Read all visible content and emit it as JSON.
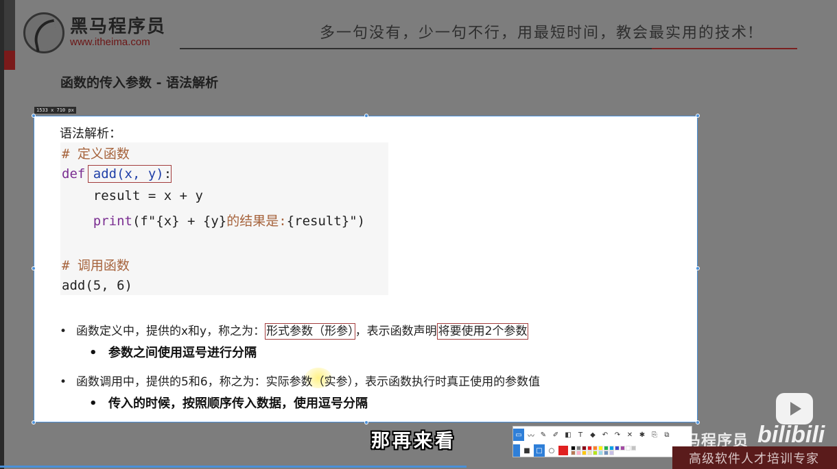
{
  "header": {
    "logo_cn": "黑马程序员",
    "logo_url": "www.itheima.com",
    "slogan": "多一句没有，少一句不行，用最短时间，教会最实用的技术!"
  },
  "slide": {
    "title": "函数的传入参数 - 语法解析",
    "dimension_badge": "1533 x 710  px"
  },
  "content": {
    "syntax_label": "语法解析：",
    "code": {
      "comment_define": "# 定义函数",
      "def_kw": "def",
      "def_call": "add(x, y)",
      "def_colon": ":",
      "line_result": "    result = x + y",
      "print_indent": "    ",
      "print_fn": "print",
      "print_open": "(f\"{x} + {y}",
      "print_str": "的结果是:",
      "print_close": "{result}\")",
      "comment_call": "# 调用函数",
      "call_line": "add(5, 6)"
    },
    "bullets": {
      "b1_pre": "函数定义中，提供的x和y，称之为：",
      "b1_box1": "形式参数（形参）",
      "b1_mid": "，表示函数声明",
      "b1_box2": "将要使用2个参数",
      "b1_sub": "参数之间使用逗号进行分隔",
      "b2_text": "函数调用中，提供的5和6，称之为：实际参数（实参），表示函数执行时真正使用的参数值",
      "b2_sub": "传入的时候，按照顺序传入数据，使用逗号分隔",
      "dot": "•"
    }
  },
  "overlay": {
    "subtitle": "那再来看",
    "watermark_cn": "黑马程序员",
    "bili_logo": "bilibili",
    "bottom_slogan": "高级软件人才培训专家"
  },
  "toolbar": {
    "row1": [
      "▭",
      "〰",
      "✎",
      "✐",
      "◧",
      "T",
      "◆",
      "↶",
      "↷",
      "✕",
      "✱",
      "⎘",
      "⧉"
    ],
    "row2_shapes": [
      "■",
      "□",
      "○"
    ],
    "active_color": "#e02020",
    "palette": [
      "#000000",
      "#7f7f7f",
      "#880015",
      "#ed1c24",
      "#ff7f27",
      "#fff200",
      "#22b14c",
      "#00a2e8",
      "#3f48cc",
      "#a349a4",
      "#ffffff",
      "#c3c3c3",
      "#b97a57",
      "#ffaec9",
      "#ffc90e",
      "#efe4b0",
      "#b5e61d",
      "#99d9ea",
      "#7092be",
      "#c8bfe7"
    ]
  },
  "colors": {
    "keyword": "#7a2e91",
    "function": "#1f3fa8",
    "comment": "#a6633c",
    "box_border": "#a23b3b",
    "selection": "#4a90d9"
  }
}
